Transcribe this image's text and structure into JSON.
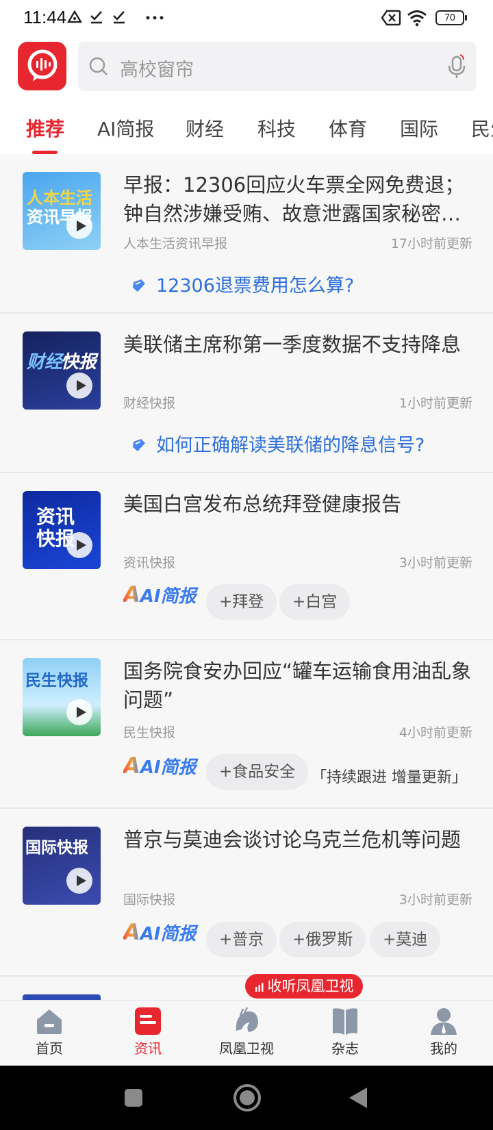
{
  "status_bar": {
    "time": "11:44",
    "battery": "70"
  },
  "search": {
    "placeholder": "高校窗帘"
  },
  "tabs": [
    "推荐",
    "AI简报",
    "财经",
    "科技",
    "体育",
    "国际",
    "民生"
  ],
  "thumbnails": [
    {
      "lines": [
        "人本生活",
        "资讯早报"
      ],
      "colors": [
        "#4aa6ee",
        "#f4d642"
      ]
    },
    {
      "lines": [
        "财经",
        "快报"
      ],
      "colors": [
        "#14225e",
        "#7cc3ff"
      ]
    },
    {
      "lines": [
        "资讯",
        "快报"
      ],
      "colors": [
        "#0e2aa0",
        "#ffffff"
      ]
    },
    {
      "lines": [
        "民生快报"
      ],
      "colors": [
        "#8fd0f5",
        "#2468c8"
      ]
    },
    {
      "lines": [
        "国际快报"
      ],
      "colors": [
        "#25307a",
        "#ffffff"
      ]
    }
  ],
  "cards": [
    {
      "title": "早报：12306回应火车票全网免费退；钟自然涉嫌受贿、故意泄露国家秘密…",
      "source": "人本生活资讯早报",
      "updated": "17小时前更新",
      "question": "12306退票费用怎么算?"
    },
    {
      "title": "美联储主席称第一季度数据不支持降息",
      "source": "财经快报",
      "updated": "1小时前更新",
      "question": "如何正确解读美联储的降息信号?"
    },
    {
      "title": "美国白宫发布总统拜登健康报告",
      "source": "资讯快报",
      "updated": "3小时前更新",
      "ai_label": "AI简报",
      "chips": [
        "+拜登",
        "+白宫"
      ]
    },
    {
      "title": "国务院食安办回应“罐车运输食用油乱象问题”",
      "source": "民生快报",
      "updated": "4小时前更新",
      "ai_label": "AI简报",
      "chips": [
        "+食品安全"
      ],
      "follow": "「持续跟进 增量更新」"
    },
    {
      "title": "普京与莫迪会谈讨论乌克兰危机等问题",
      "source": "国际快报",
      "updated": "3小时前更新",
      "ai_label": "AI简报",
      "chips": [
        "+普京",
        "+俄罗斯",
        "+莫迪"
      ]
    }
  ],
  "listen_button": "收听凤凰卫视",
  "bottom_nav": [
    "首页",
    "资讯",
    "凤凰卫视",
    "杂志",
    "我的"
  ],
  "colors": {
    "accent": "#e8262f",
    "link": "#2d6fdc"
  }
}
